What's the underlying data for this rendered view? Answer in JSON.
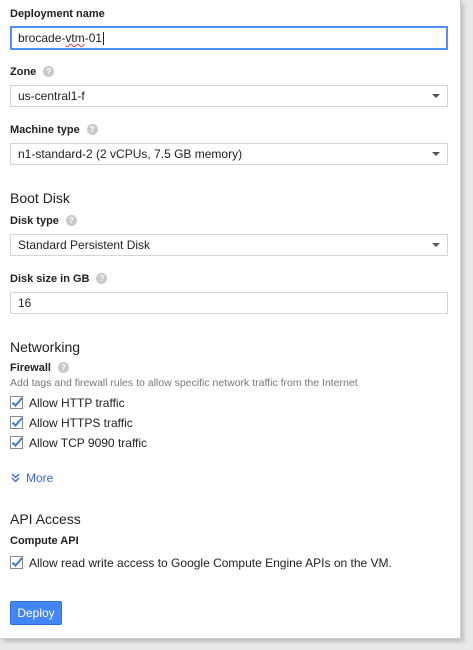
{
  "deployment": {
    "label": "Deployment name",
    "value_prefix": "brocade-",
    "value_misspelled": "vtm",
    "value_suffix": "-01"
  },
  "zone": {
    "label": "Zone",
    "value": "us-central1-f"
  },
  "machine_type": {
    "label": "Machine type",
    "value": "n1-standard-2 (2 vCPUs, 7.5 GB memory)"
  },
  "boot_disk": {
    "heading": "Boot Disk",
    "disk_type_label": "Disk type",
    "disk_type_value": "Standard Persistent Disk",
    "disk_size_label": "Disk size in GB",
    "disk_size_value": "16"
  },
  "networking": {
    "heading": "Networking",
    "firewall_label": "Firewall",
    "firewall_hint": "Add tags and firewall rules to allow specific network traffic from the Internet",
    "rules": [
      {
        "label": "Allow HTTP traffic",
        "checked": true
      },
      {
        "label": "Allow HTTPS traffic",
        "checked": true
      },
      {
        "label": "Allow TCP 9090 traffic",
        "checked": true
      }
    ],
    "more_label": "More"
  },
  "api_access": {
    "heading": "API Access",
    "compute_label": "Compute API",
    "compute_option": "Allow read write access to Google Compute Engine APIs on the VM.",
    "compute_checked": true
  },
  "deploy_label": "Deploy",
  "help_glyph": "?",
  "colors": {
    "accent": "#4285f4",
    "link": "#3367d6",
    "focus": "#4d90fe"
  }
}
